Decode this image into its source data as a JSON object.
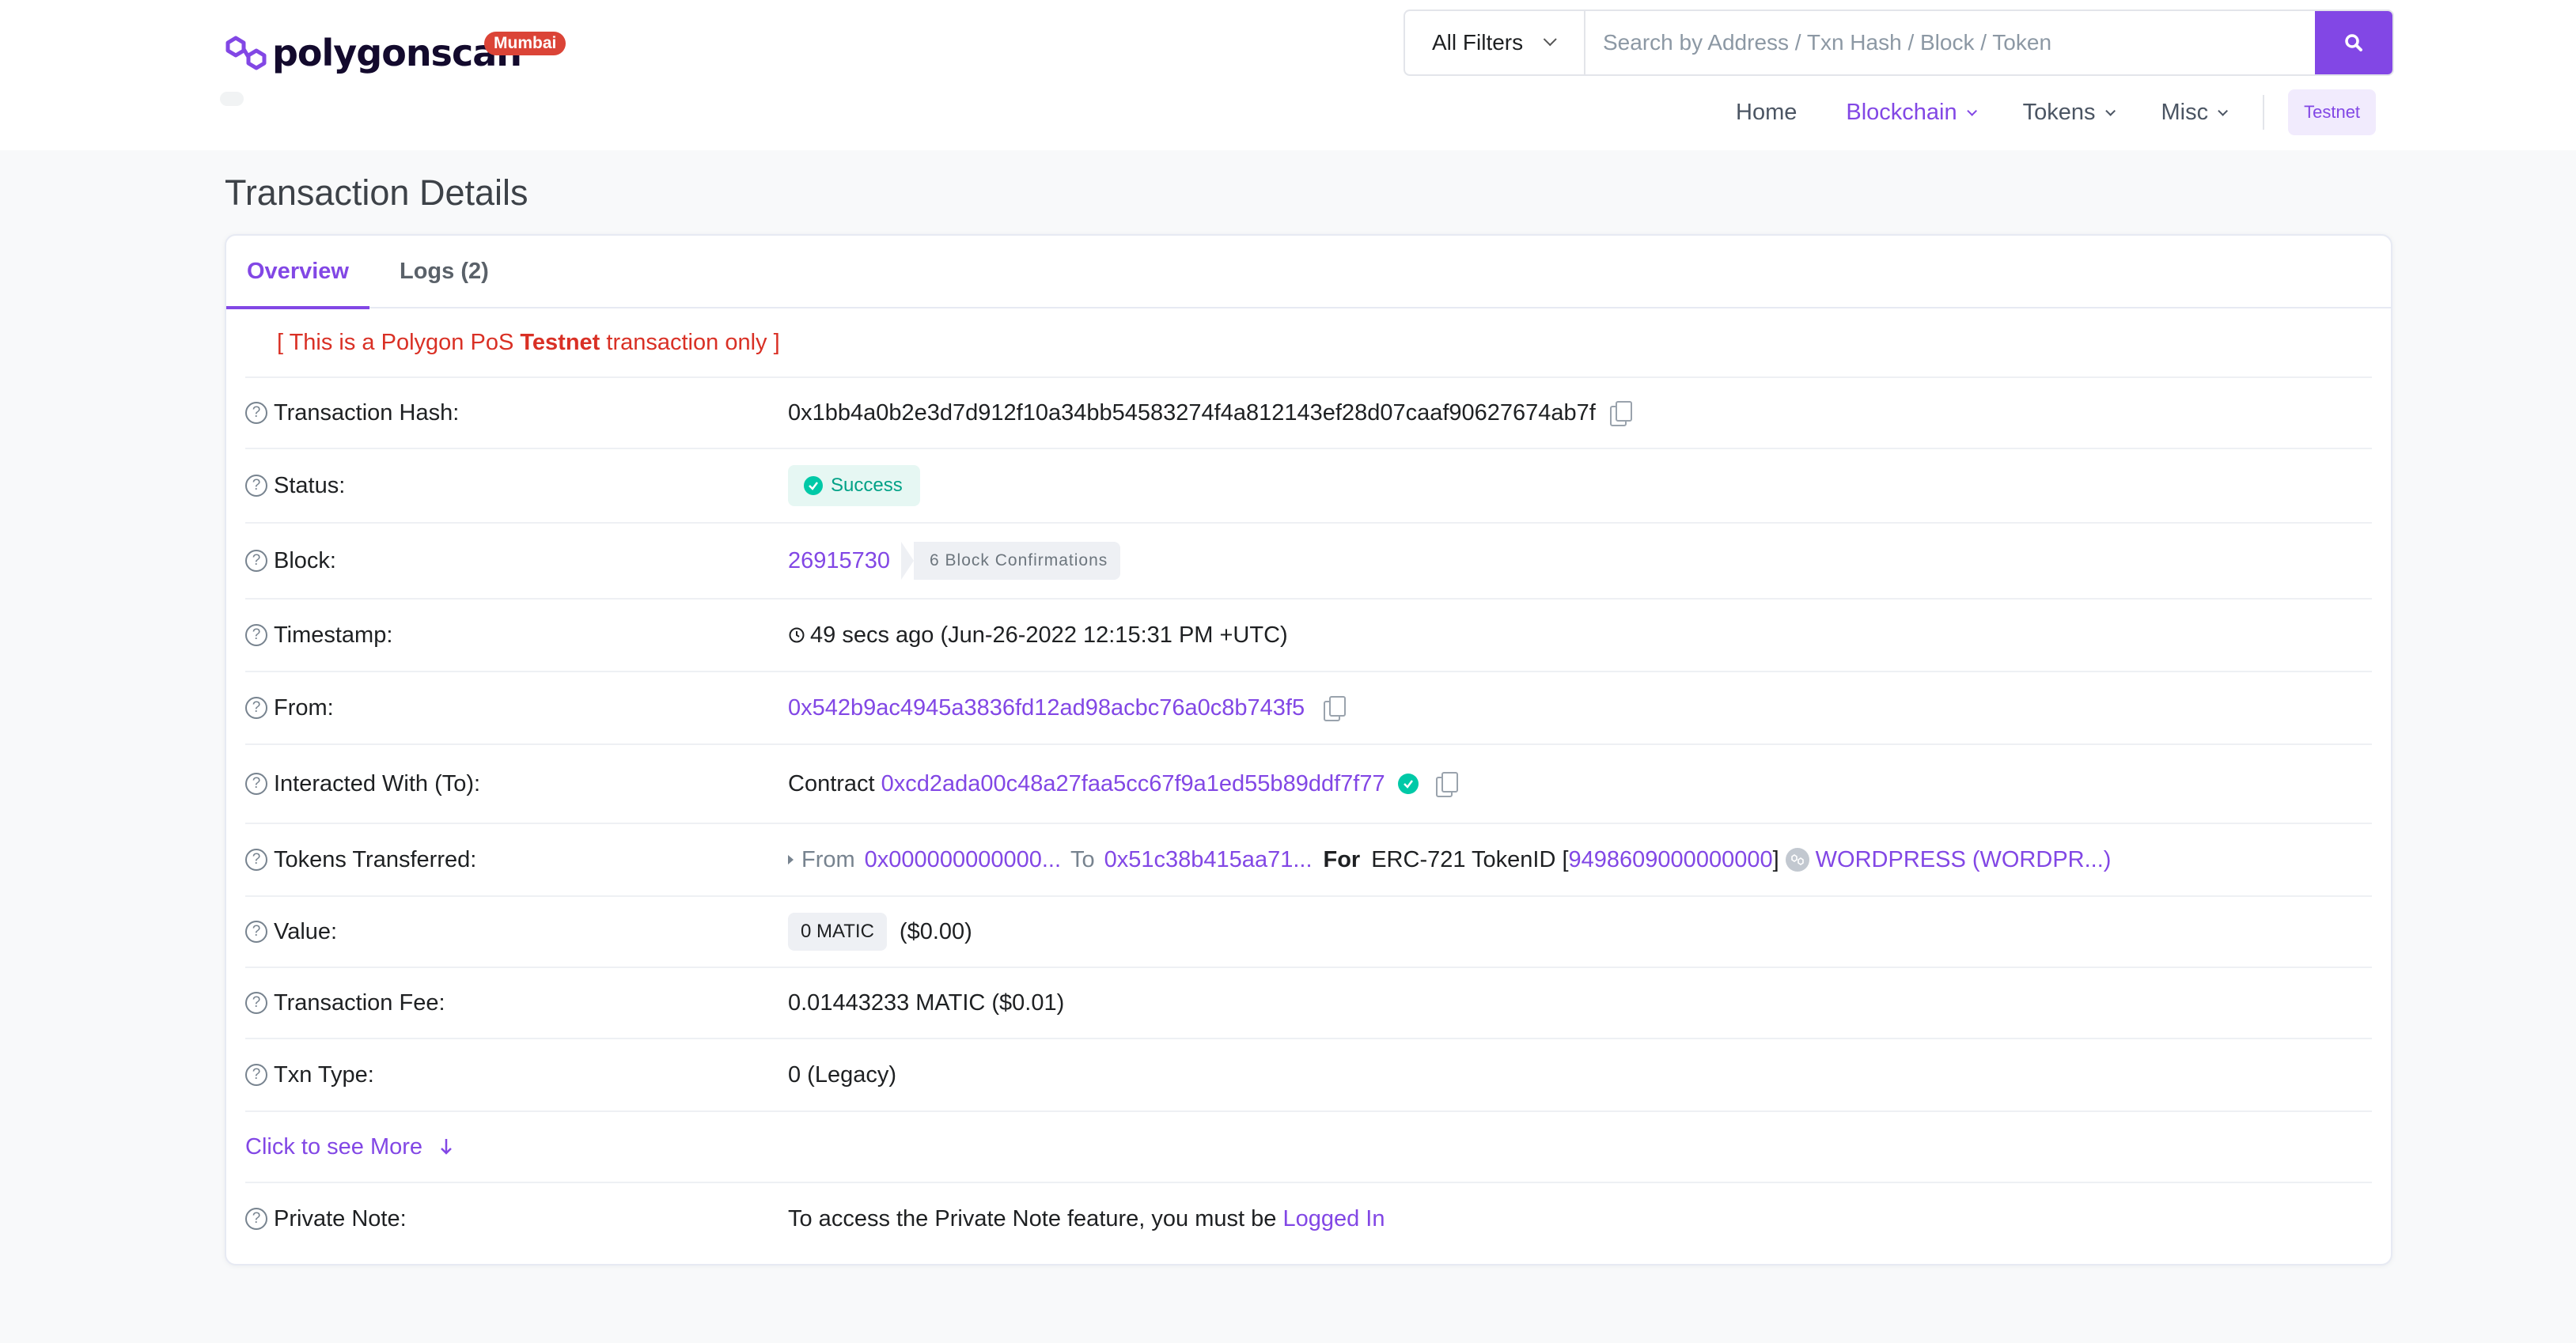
{
  "header": {
    "logo_text": "polygonscan",
    "network_badge": "Mumbai",
    "search": {
      "filter_label": "All Filters",
      "placeholder": "Search by Address / Txn Hash / Block / Token",
      "value": ""
    },
    "nav": [
      {
        "label": "Home",
        "active": false
      },
      {
        "label": "Blockchain",
        "active": true
      },
      {
        "label": "Tokens",
        "active": false
      },
      {
        "label": "Misc",
        "active": false
      }
    ],
    "testnet_label": "Testnet"
  },
  "page": {
    "title": "Transaction Details",
    "tabs": [
      {
        "label": "Overview",
        "active": true
      },
      {
        "label": "Logs (2)",
        "active": false
      }
    ],
    "notice": {
      "prefix": "[ This is a Polygon PoS ",
      "bold": "Testnet",
      "suffix": " transaction only ]"
    }
  },
  "details": {
    "tx_hash": {
      "label": "Transaction Hash:",
      "value": "0x1bb4a0b2e3d7d912f10a34bb54583274f4a812143ef28d07caaf90627674ab7f"
    },
    "status": {
      "label": "Status:",
      "value": "Success",
      "color": "#00a186"
    },
    "block": {
      "label": "Block:",
      "value": "26915730",
      "confirmations": "6 Block Confirmations"
    },
    "timestamp": {
      "label": "Timestamp:",
      "value": "49 secs ago (Jun-26-2022 12:15:31 PM +UTC)"
    },
    "from": {
      "label": "From:",
      "value": "0x542b9ac4945a3836fd12ad98acbc76a0c8b743f5"
    },
    "to": {
      "label": "Interacted With (To):",
      "prefix": "Contract",
      "value": "0xcd2ada00c48a27faa5cc67f9a1ed55b89ddf7f77"
    },
    "tokens": {
      "label": "Tokens Transferred:",
      "from_label": "From",
      "from_addr": "0x000000000000...",
      "to_label": "To",
      "to_addr": "0x51c38b415aa71...",
      "for_label": "For",
      "standard": "ERC-721 TokenID [",
      "token_id": "9498609000000000",
      "close": "]",
      "token_name": "WORDPRESS (WORDPR...)"
    },
    "value": {
      "label": "Value:",
      "amount": "0 MATIC",
      "usd": "($0.00)"
    },
    "fee": {
      "label": "Transaction Fee:",
      "value": "0.01443233 MATIC ($0.01)"
    },
    "txn_type": {
      "label": "Txn Type:",
      "value": "0 (Legacy)"
    },
    "see_more": "Click to see More",
    "private_note": {
      "label": "Private Note:",
      "text": "To access the Private Note feature, you must be ",
      "link": "Logged In"
    }
  },
  "colors": {
    "accent": "#8247e5",
    "danger": "#d93025",
    "success": "#00c9a7"
  }
}
